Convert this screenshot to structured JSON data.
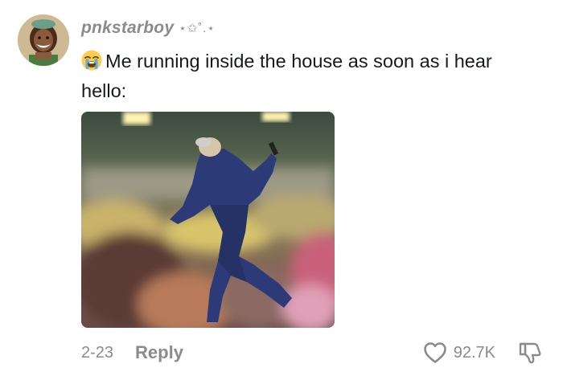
{
  "comment": {
    "username": "pnkstarboy",
    "username_decoration": "⋆✩˚.⋆",
    "emoji": "sob-emoji",
    "text": "Me running inside the house as soon as i hear hello:",
    "date": "2-23",
    "reply_label": "Reply",
    "like_count": "92.7K"
  },
  "icons": {
    "like": "heart-outline-icon",
    "dislike": "thumbs-down-outline-icon"
  },
  "colors": {
    "text_primary": "#161823",
    "text_secondary": "#8a8b91",
    "background": "#ffffff"
  }
}
